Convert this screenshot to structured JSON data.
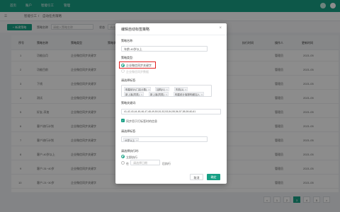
{
  "topbar": {
    "nav": [
      "首页",
      "账户",
      "智能引工",
      "管理"
    ]
  },
  "breadcrumb": {
    "a": "智能引工",
    "b": "/",
    "c": "自动任务策略"
  },
  "toolbar": {
    "add_label": "+ 新建策略",
    "filter1_label": "策略名称",
    "filter1_placeholder": "请输入策略名称",
    "filter2_label": "状态",
    "filter2_placeholder": "请选择"
  },
  "table": {
    "headers": [
      "序号",
      "策略名称",
      "策略类型",
      "策略状态",
      "执行时间",
      "操作人",
      "更新时间",
      "创建时间"
    ],
    "rows": [
      {
        "no": "1",
        "name": "功能自月",
        "type": "企业微信同步关键字",
        "status": "启用",
        "op": "管理员",
        "time": "2021-05"
      },
      {
        "no": "2",
        "name": "功能目前",
        "type": "企业微信同步关键字",
        "status": "启用",
        "op": "管理员",
        "time": "2021-05"
      },
      {
        "no": "3",
        "name": "下线",
        "type": "企业微信同步关键字",
        "status": "启用",
        "op": "管理员",
        "time": "2021-05"
      },
      {
        "no": "4",
        "name": "测试",
        "type": "企业微信同步关键字",
        "status": "启用",
        "op": "管理员",
        "time": "2021-05"
      },
      {
        "no": "5",
        "name": "好友-添加",
        "type": "企业微信同步关键字",
        "status": "启用",
        "op": "管理员",
        "time": "2021-05"
      },
      {
        "no": "6",
        "name": "客户流行计划",
        "type": "企业微信同步关键字",
        "status": "启用",
        "op": "管理员",
        "time": "2021-05"
      },
      {
        "no": "7",
        "name": "客户流行计划",
        "type": "企业微信同步关键字",
        "status": "启用",
        "op": "管理员",
        "time": "2021-05"
      },
      {
        "no": "8",
        "name": "客户-40岁以上",
        "type": "企业微信同步关键字",
        "status": "启用",
        "op": "管理员",
        "time": "2021-05"
      },
      {
        "no": "9",
        "name": "客户-31~40岁",
        "type": "企业微信同步关键字",
        "status": "启用",
        "op": "管理员",
        "time": "2021-05"
      },
      {
        "no": "10",
        "name": "客户-21~30岁",
        "type": "企业微信同步关键字",
        "status": "启用",
        "op": "管理员",
        "time": "2021-05"
      }
    ]
  },
  "pagination": {
    "prev": "<",
    "pages": [
      "1",
      "2",
      "3",
      "4",
      "5"
    ],
    "active": "3",
    "next": ">"
  },
  "modal": {
    "title": "编辑自动标签策略",
    "close": "×",
    "name_label": "策略名称:",
    "name_value": "年龄-40岁以上",
    "type_label": "策略类型:",
    "type_option1": "企业微信同步关键字",
    "type_option2": "企业微信同步数据",
    "keywords_label": "请选择标签:",
    "tags": [
      {
        "text": "明星统计(门店计数)"
      },
      {
        "text": "加购(V)"
      },
      {
        "text": "失败(1)"
      },
      {
        "text": "新上客(同类)"
      },
      {
        "text": "新上客(同类)"
      },
      {
        "text": "明星统计客服明细加入"
      }
    ],
    "tag_close": "×",
    "kw_label": "策略关键词:",
    "kw_value": "41,42,43,44,45,46,47,48,49,50,51,52,53,54,55,56,57,58,59,60,61",
    "check_text": "同步用于打标签时的信息",
    "rule_label": "请选择标签:",
    "rule_value": "40岁以上",
    "exec_label": "请选择执行时:",
    "exec_option1": "立即执行",
    "exec_option2_prefix": "在",
    "exec_option2_placeholder": "请选择日期",
    "exec_option2_suffix": "后执行",
    "cancel": "取消",
    "confirm": "确定"
  },
  "colors": {
    "accent": "#18a085",
    "highlight": "#e02020"
  }
}
